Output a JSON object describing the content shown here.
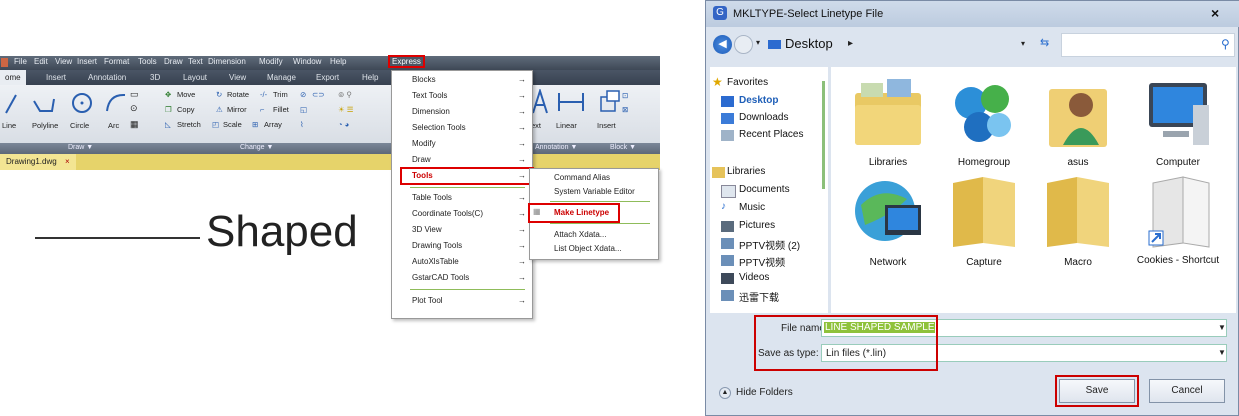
{
  "cad": {
    "menubar": [
      "File",
      "Edit",
      "View",
      "Insert",
      "Format",
      "Tools",
      "Draw",
      "Text",
      "Dimension",
      "Modify",
      "Window",
      "Help"
    ],
    "express_label": "Express",
    "ribbon_tabs": [
      "ome",
      "Insert",
      "Annotation",
      "3D",
      "Layout",
      "View",
      "Manage",
      "Export",
      "Help"
    ],
    "draw_buttons": [
      "Line",
      "Polyline",
      "Circle",
      "Arc"
    ],
    "modify_buttons": [
      "Move",
      "Rotate",
      "Trim",
      "Copy",
      "Mirror",
      "Fillet",
      "Stretch",
      "Scale",
      "Array"
    ],
    "right_buttons": [
      "ext",
      "Linear",
      "Insert"
    ],
    "groups": {
      "draw": "Draw",
      "change": "Change",
      "annotation": "Annotation",
      "block": "Block"
    },
    "doc_tab": "Drawing1.dwg",
    "doc_close": "×",
    "canvas_text": "Shaped",
    "express_menu": [
      "Blocks",
      "Text Tools",
      "Dimension",
      "Selection Tools",
      "Modify",
      "Draw",
      "Tools",
      "Table Tools",
      "Coordinate Tools(C)",
      "3D View",
      "Drawing Tools",
      "AutoXlsTable",
      "GstarCAD Tools",
      "Plot Tool"
    ],
    "submenu": [
      "Command Alias",
      "System Variable Editor",
      "Make Linetype",
      "Attach Xdata...",
      "List Object Xdata..."
    ],
    "arrow": "→"
  },
  "dialog": {
    "title": "MKLTYPE-Select Linetype File",
    "close": "×",
    "address": "Desktop",
    "address_sep": "▸",
    "nav": {
      "favorites": "Favorites",
      "favorites_items": [
        "Desktop",
        "Downloads",
        "Recent Places"
      ],
      "libraries": "Libraries",
      "libraries_items": [
        "Documents",
        "Music",
        "Pictures",
        "PPTV视频 (2)",
        "PPTV视频",
        "Videos",
        "迅雷下载"
      ]
    },
    "files": [
      "Libraries",
      "Homegroup",
      "asus",
      "Computer",
      "Network",
      "Capture",
      "Macro",
      "Cookies - Shortcut"
    ],
    "file_name_label": "File name:",
    "file_name_value": "LINE SHAPED SAMPLE",
    "save_type_label": "Save as type:",
    "save_type_value": "Lin files (*.lin)",
    "hide_folders": "Hide Folders",
    "save": "Save",
    "cancel": "Cancel"
  }
}
